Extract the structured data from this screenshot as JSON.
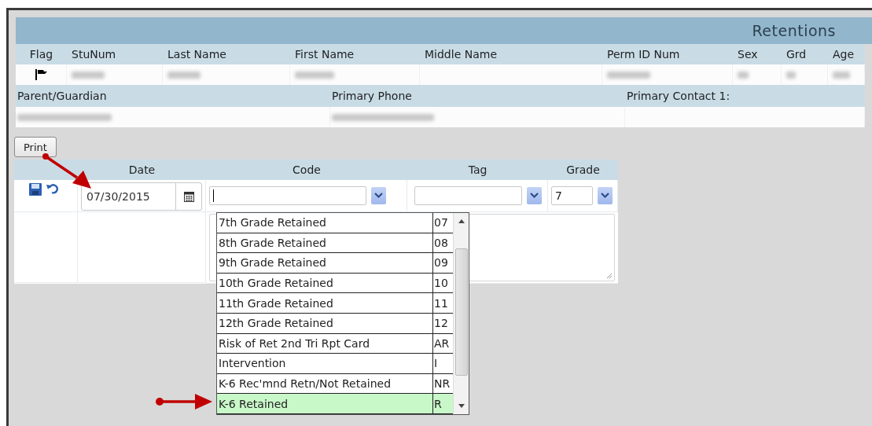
{
  "header": {
    "title": "Retentions"
  },
  "student_table": {
    "columns": [
      {
        "label": "Flag",
        "kind": "flag",
        "flagged": true
      },
      {
        "label": "StuNum",
        "kind": "value",
        "redacted": true
      },
      {
        "label": "Last Name",
        "kind": "value",
        "redacted": true
      },
      {
        "label": "First Name",
        "kind": "value",
        "redacted": true
      },
      {
        "label": "Middle Name",
        "kind": "value",
        "redacted": false
      },
      {
        "label": "Perm ID Num",
        "kind": "value",
        "redacted": true
      },
      {
        "label": "Sex",
        "kind": "value",
        "redacted": true
      },
      {
        "label": "Grd",
        "kind": "value",
        "redacted": true
      },
      {
        "label": "Age",
        "kind": "value",
        "redacted": true
      }
    ]
  },
  "contact_table": {
    "columns": [
      {
        "label": "Parent/Guardian",
        "redacted": true
      },
      {
        "label": "Primary Phone",
        "redacted": true
      },
      {
        "label": "Primary Contact 1:",
        "redacted": false
      }
    ]
  },
  "print_button": "Print",
  "grid": {
    "columns": [
      "Date",
      "Code",
      "Tag",
      "Grade"
    ],
    "row": {
      "date": "07/30/2015",
      "code_focused": true,
      "grade": "7"
    }
  },
  "dropdown": {
    "options": [
      {
        "name": "7th Grade Retained",
        "code": "07",
        "selected": false
      },
      {
        "name": "8th Grade Retained",
        "code": "08",
        "selected": false
      },
      {
        "name": "9th Grade Retained",
        "code": "09",
        "selected": false
      },
      {
        "name": "10th Grade Retained",
        "code": "10",
        "selected": false
      },
      {
        "name": "11th Grade Retained",
        "code": "11",
        "selected": false
      },
      {
        "name": "12th Grade Retained",
        "code": "12",
        "selected": false
      },
      {
        "name": "Risk of Ret 2nd Tri Rpt Card",
        "code": "AR",
        "selected": false
      },
      {
        "name": "Intervention",
        "code": "I",
        "selected": false
      },
      {
        "name": "K-6 Rec'mnd Retn/Not Retained",
        "code": "NR",
        "selected": false
      },
      {
        "name": "K-6 Retained",
        "code": "R",
        "selected": true
      }
    ]
  }
}
